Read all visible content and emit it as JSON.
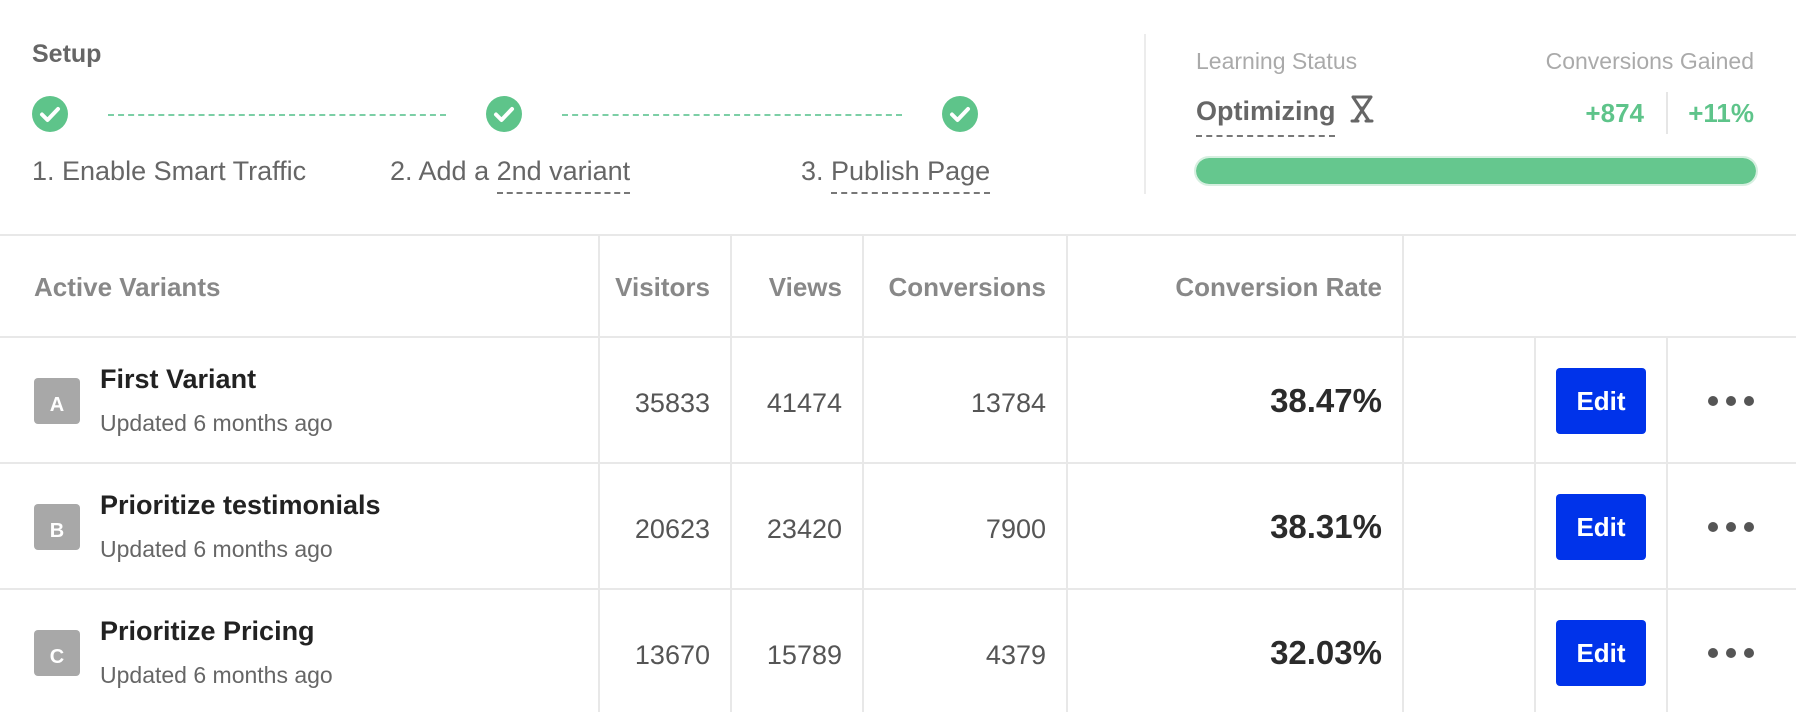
{
  "setup": {
    "title": "Setup",
    "steps": [
      {
        "label_prefix": "1. Enable Smart Traffic",
        "label_underlined": ""
      },
      {
        "label_prefix": "2. Add a ",
        "label_underlined": "2nd variant"
      },
      {
        "label_prefix": "3. ",
        "label_underlined": "Publish Page"
      }
    ]
  },
  "learning": {
    "label": "Learning Status",
    "value": "Optimizing",
    "icon": "optimizing-icon"
  },
  "conversions_gained": {
    "label": "Conversions Gained",
    "count": "+874",
    "percent": "+11%",
    "progress": 1.0
  },
  "colors": {
    "accent_green": "#5ec48a",
    "edit_blue": "#0033ea",
    "badge_gray": "#a8a8a8"
  },
  "table": {
    "headers": {
      "variant": "Active Variants",
      "visitors": "Visitors",
      "views": "Views",
      "conversions": "Conversions",
      "rate": "Conversion Rate"
    },
    "rows": [
      {
        "badge": "A",
        "name": "First Variant",
        "updated": "Updated 6 months ago",
        "visitors": "35833",
        "views": "41474",
        "conversions": "13784",
        "rate": "38.47%",
        "edit": "Edit"
      },
      {
        "badge": "B",
        "name": "Prioritize testimonials",
        "updated": "Updated 6 months ago",
        "visitors": "20623",
        "views": "23420",
        "conversions": "7900",
        "rate": "38.31%",
        "edit": "Edit"
      },
      {
        "badge": "C",
        "name": "Prioritize Pricing",
        "updated": "Updated 6 months ago",
        "visitors": "13670",
        "views": "15789",
        "conversions": "4379",
        "rate": "32.03%",
        "edit": "Edit"
      }
    ]
  }
}
